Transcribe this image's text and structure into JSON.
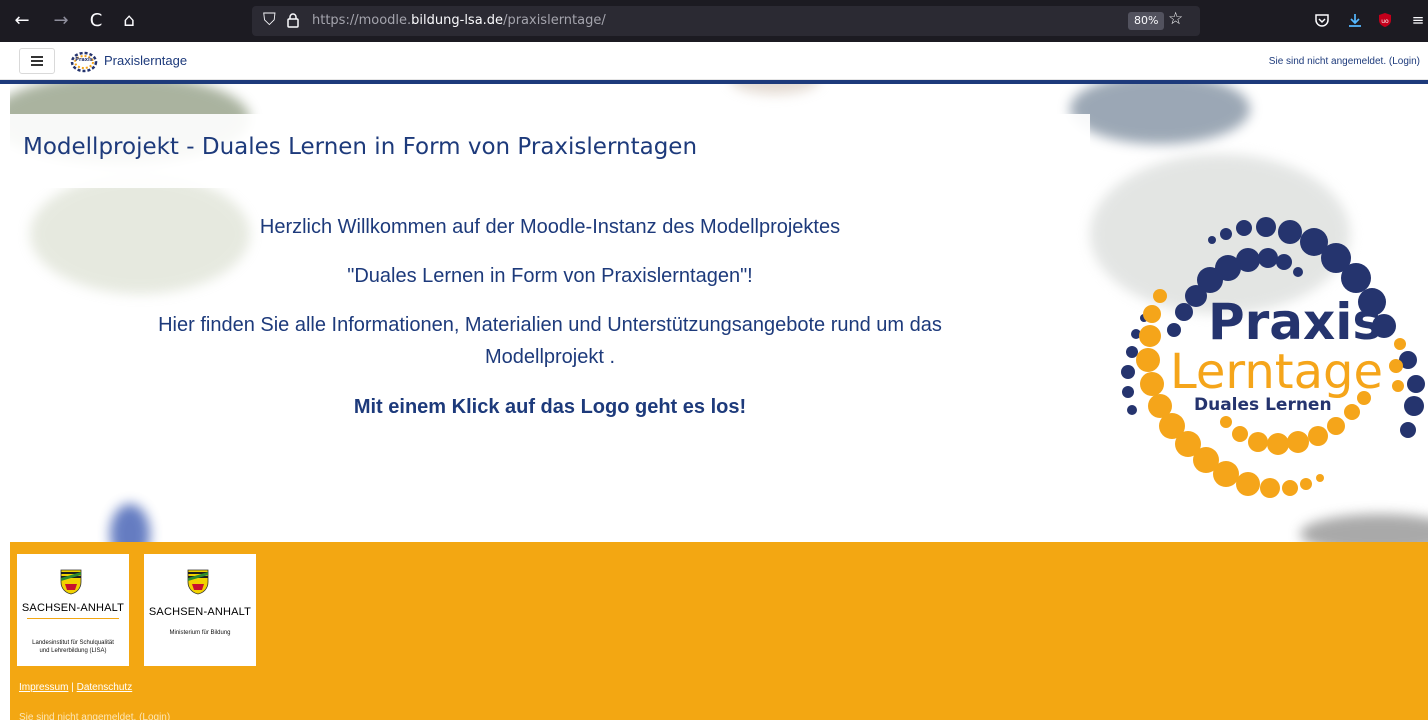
{
  "browser": {
    "url_prefix": "https://moodle.",
    "url_host": "bildung-lsa.de",
    "url_path": "/praxislerntage/",
    "zoom": "80%"
  },
  "moodle_nav": {
    "site_name": "Praxislerntage",
    "login_info": "Sie sind nicht angemeldet. (Login)"
  },
  "main": {
    "page_title": "Modellprojekt - Duales Lernen in Form von Praxislerntagen",
    "welcome_line1": "Herzlich Willkommen auf der Moodle-Instanz des Modellprojektes",
    "welcome_line2": "\"Duales Lernen in Form von Praxislerntagen\"!",
    "info_line1": "Hier finden Sie alle Informationen, Materialien und Unterstützungsangebote rund um das",
    "info_line2": "Modellprojekt .",
    "call_to_action": "Mit einem Klick auf das Logo geht es los!",
    "logo": {
      "word1": "Praxis",
      "word2": "Lerntage",
      "tagline": "Duales Lernen",
      "color_blue": "#25346e",
      "color_orange": "#f5a51a"
    }
  },
  "footer": {
    "sponsor1": {
      "state": "SACHSEN-ANHALT",
      "org_line1": "Landesinstitut für Schulqualität",
      "org_line2": "und Lehrerbildung (LISA)"
    },
    "sponsor2": {
      "state": "SACHSEN-ANHALT",
      "org_line1": "Ministerium für Bildung"
    },
    "link_impressum": "Impressum",
    "link_separator": "|",
    "link_datenschutz": "Datenschutz",
    "login_info": "Sie sind nicht angemeldet. (Login)",
    "color": "#f3a712"
  },
  "icons": {
    "back": "←",
    "forward": "→",
    "reload": "C",
    "home": "⌂",
    "shield": "⛉",
    "lock": "🔒",
    "star": "☆",
    "pocket": "⊙",
    "download": "↓",
    "ublock": "uo",
    "menu": "≡",
    "hamburger": "≡"
  }
}
